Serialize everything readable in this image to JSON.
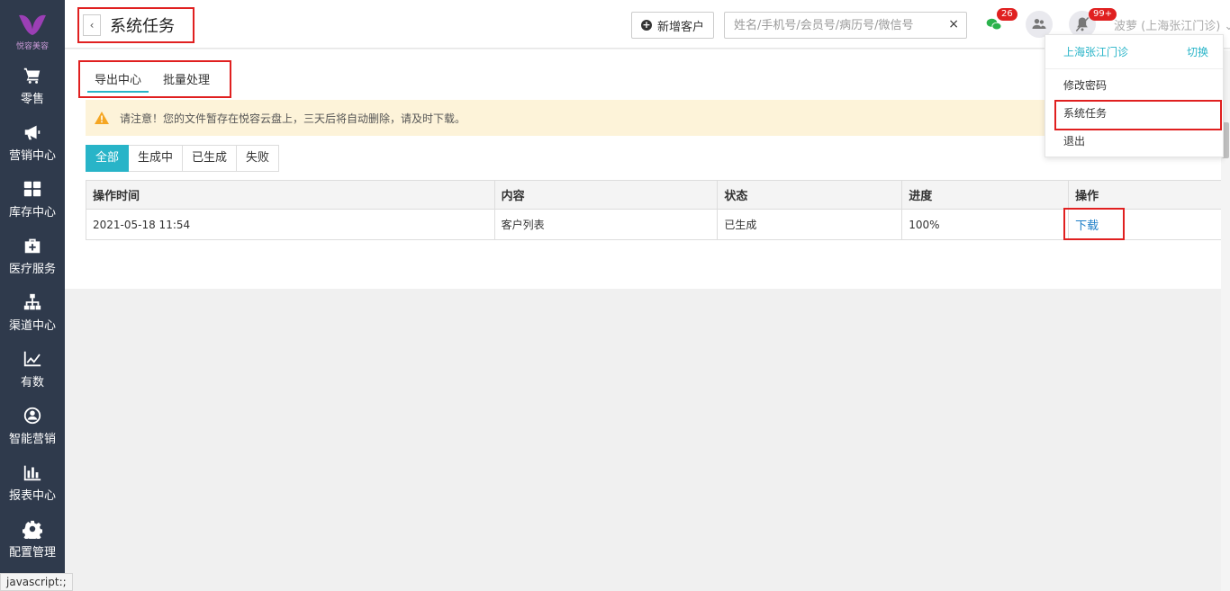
{
  "sidebar": {
    "logo_text": "悦容美容",
    "items": [
      {
        "label": "零售",
        "icon": "cart-icon"
      },
      {
        "label": "营销中心",
        "icon": "megaphone-icon"
      },
      {
        "label": "库存中心",
        "icon": "grid-icon"
      },
      {
        "label": "医疗服务",
        "icon": "medkit-icon"
      },
      {
        "label": "渠道中心",
        "icon": "sitemap-icon"
      },
      {
        "label": "有数",
        "icon": "line-chart-icon"
      },
      {
        "label": "智能营销",
        "icon": "smart-marketing-icon"
      },
      {
        "label": "报表中心",
        "icon": "bar-chart-icon"
      },
      {
        "label": "配置管理",
        "icon": "gear-icon"
      }
    ]
  },
  "status_bar": "javascript:;",
  "header": {
    "back_glyph": "‹",
    "title": "系统任务",
    "add_customer_label": "新增客户",
    "search_placeholder": "姓名/手机号/会员号/病历号/微信号",
    "search_clear": "×",
    "wechat_badge": "26",
    "notify_badge": "99+",
    "user_name": "波萝 (上海张江门诊) ⌄"
  },
  "dropdown": {
    "store": "上海张江门诊",
    "switch": "切换",
    "items": [
      "修改密码",
      "系统任务",
      "退出"
    ]
  },
  "tabs": [
    "导出中心",
    "批量处理"
  ],
  "notice": "请注意！您的文件暂存在悦容云盘上，三天后将自动删除，请及时下载。",
  "filters": [
    "全部",
    "生成中",
    "已生成",
    "失败"
  ],
  "table": {
    "columns": [
      "操作时间",
      "内容",
      "状态",
      "进度",
      "操作"
    ],
    "rows": [
      {
        "time": "2021-05-18 11:54",
        "content": "客户列表",
        "status": "已生成",
        "progress": "100%",
        "action": "下载"
      }
    ]
  },
  "colors": {
    "accent": "#28b4c8",
    "sidebar": "#2f3a4c",
    "highlight": "#e02020",
    "notice_bg": "#fdf3d9"
  }
}
